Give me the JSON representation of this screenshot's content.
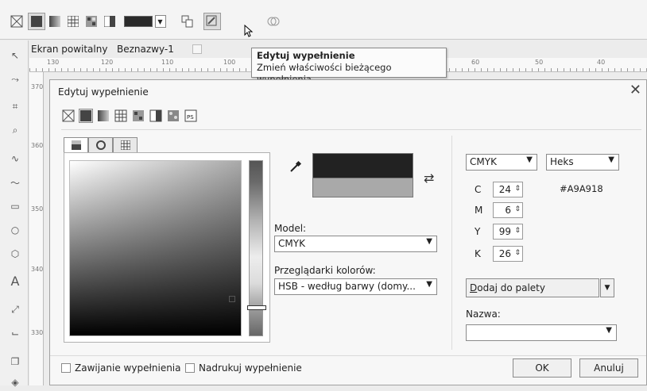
{
  "ruler": {
    "h_ticks": [
      "130",
      "120",
      "110",
      "100",
      "60",
      "50",
      "40"
    ],
    "v_ticks": [
      "370",
      "360",
      "350",
      "340",
      "330"
    ]
  },
  "doc_tabs": [
    "Ekran powitalny",
    "Beznazwy-1"
  ],
  "tooltip": {
    "title": "Edytuj wypełnienie",
    "body": "Zmień właściwości bieżącego wypełnienia."
  },
  "dialog": {
    "title": "Edytuj wypełnienie",
    "close_glyph": "✕",
    "fill_types": [
      "no-fill",
      "uniform-fill",
      "fountain-fill",
      "pattern-fill",
      "bitmap-fill",
      "two-color-fill",
      "texture-fill",
      "postscript-fill"
    ],
    "postscript_label": "PS",
    "model_label": "Model:",
    "model_value": "CMYK",
    "viewers_label": "Przeglądarki kolorów:",
    "viewers_value": "HSB - według barwy (domy...",
    "colorspace_value": "CMYK",
    "hex_format_value": "Heks",
    "hex_value": "#A9A918",
    "cmyk": [
      {
        "label": "C",
        "value": "24"
      },
      {
        "label": "M",
        "value": "6"
      },
      {
        "label": "Y",
        "value": "99"
      },
      {
        "label": "K",
        "value": "26"
      }
    ],
    "add_palette_label_underlined": "D",
    "add_palette_label_rest": "odaj do palety",
    "name_label": "Nazwa:",
    "name_value": "",
    "wrap_fill_label": "Zawijanie wypełnienia",
    "overprint_label": "Nadrukuj wypełnienie",
    "ok_label": "OK",
    "cancel_label": "Anuluj"
  },
  "colors": {
    "new_color": "#222222",
    "old_color": "#a9a9a9"
  }
}
